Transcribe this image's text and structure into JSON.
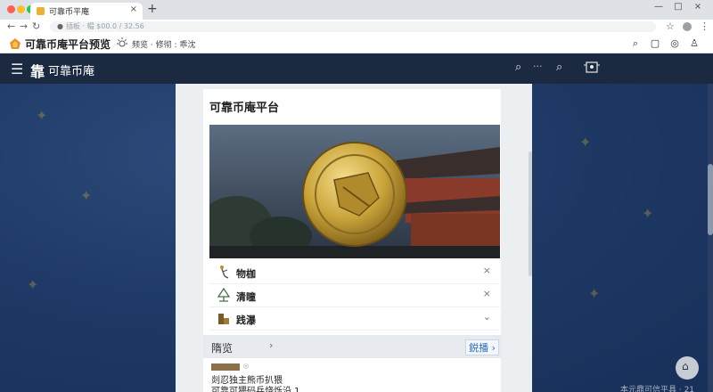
{
  "browser": {
    "tab_title": "可靠币平庵",
    "tab_close": "×",
    "new_tab": "+",
    "url": "插板 · 帽 $00.0 / 32.56",
    "window_controls": [
      "—",
      "□",
      "×"
    ]
  },
  "appbar": {
    "title": "可靠币庵平台预览",
    "weather_text": "频览 · 修彻 : 乖沈"
  },
  "navbar": {
    "brand_glyph": "靠",
    "brand": "可靠币庵",
    "more": "···"
  },
  "card": {
    "title": "可靠币庵平台"
  },
  "menu": [
    {
      "label": "物枷",
      "action": "×",
      "icon": "figure-icon"
    },
    {
      "label": "清瞳",
      "action": "×",
      "icon": "tree-icon"
    },
    {
      "label": "践瀑",
      "action": "⌄",
      "icon": "stairs-icon"
    }
  ],
  "section": {
    "title": "隋览",
    "chevron": "›",
    "more": "鋭播 ›"
  },
  "list_item": {
    "badge": "◎",
    "title": "剡忍独主熊币扒猥",
    "subtitle": "可靠可猥码兵烧烁沿 1"
  },
  "footer": {
    "text": "本元鼎可信平具 · 21"
  },
  "colors": {
    "navbar": "#1b2a40",
    "background": "#1f3a66",
    "accent_link": "#2b6cb0",
    "coin_gold": "#c9a43a"
  }
}
